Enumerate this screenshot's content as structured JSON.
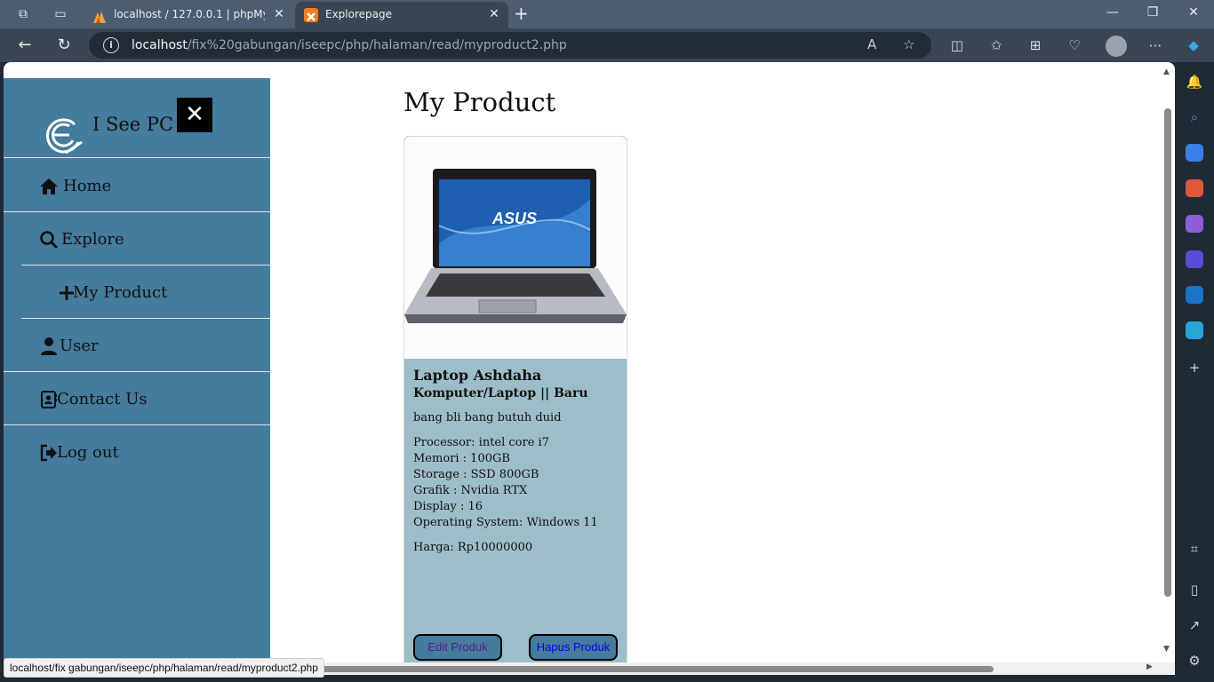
{
  "browser": {
    "tabs": [
      {
        "title": "localhost / 127.0.0.1 | phpMyAdmin",
        "favicon": "phpmyadmin-icon"
      },
      {
        "title": "Explorepage",
        "favicon": "xampp-icon"
      }
    ],
    "address": {
      "host": "localhost",
      "path": "/fix%20gabungan/iseepc/php/halaman/read/myproduct2.php"
    },
    "status_url": "localhost/fix gabungan/iseepc/php/halaman/read/myproduct2.php"
  },
  "sidebar": {
    "brand": "I See PC",
    "close_glyph": "✕",
    "items": [
      {
        "label": "Home",
        "icon": "home-icon"
      },
      {
        "label": "Explore",
        "icon": "search-icon"
      },
      {
        "label": "My Product",
        "icon": "plus-icon"
      },
      {
        "label": "User",
        "icon": "user-icon"
      },
      {
        "label": "Contact Us",
        "icon": "contact-card-icon"
      },
      {
        "label": "Log out",
        "icon": "logout-icon"
      }
    ]
  },
  "main": {
    "title": "My Product",
    "product": {
      "name": "Laptop Ashdaha",
      "category": "Komputer/Laptop || Baru",
      "description": "bang bli bang butuh duid",
      "specs": [
        "Processor: intel core i7",
        "Memori : 100GB",
        "Storage : SSD 800GB",
        "Grafik : Nvidia RTX",
        "Display : 16",
        "Operating System: Windows 11"
      ],
      "price": "Harga: Rp10000000",
      "image_brand": "ASUS",
      "edit_label": "Edit Produk",
      "delete_label": "Hapus Produk"
    }
  },
  "colors": {
    "sidebar_bg": "#457b9d",
    "card_body_bg": "#9dbdc9",
    "edit_text": "#551a8b",
    "delete_text": "#0000ee"
  }
}
